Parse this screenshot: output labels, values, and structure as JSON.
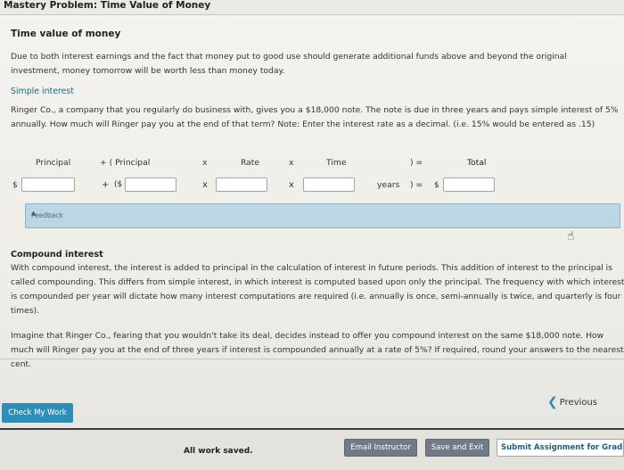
{
  "window": {
    "title": "Mastery Problem: Time Value of Money"
  },
  "section": {
    "title": "Time value of money"
  },
  "intro": "Due to both interest earnings and the fact that money put to good use should generate additional funds above and beyond the original investment, money tomorrow will be worth less than money today.",
  "simple": {
    "title": "Simple interest",
    "text": "Ringer Co., a company that you regularly do business with, gives you a $18,000 note. The note is due in three years and pays simple interest of 5% annually. How much will Ringer pay you at the end of that term? Note: Enter the interest rate as a decimal. (i.e. 15% would be entered as .15)",
    "headers": {
      "principal": "Principal",
      "plus_principal": "+  ( Principal",
      "x1": "x",
      "rate": "Rate",
      "x2": "x",
      "time": "Time",
      "close_eq": ")  =",
      "total": "Total"
    },
    "row": {
      "dollar1": "$",
      "plus": "+",
      "open_dollar": "($",
      "x1": "x",
      "x2": "x",
      "years": "years",
      "close_eq": ")  =",
      "dollar_total": "$"
    },
    "inputs": {
      "principal": "",
      "principal2": "",
      "rate": "",
      "time": "",
      "total": ""
    }
  },
  "feedback": {
    "label": "Feedback",
    "arrow": "▲"
  },
  "compound": {
    "title": "Compound interest",
    "text": "With compound interest, the interest is added to principal in the calculation of interest in future periods. This addition of interest to the principal is called compounding. This differs from simple interest, in which interest is computed based upon only the principal. The frequency with which interest is compounded per year will dictate how many interest computations are required (i.e. annually is once, semi-annually is twice, and quarterly is four times).",
    "question": "Imagine that Ringer Co., fearing that you wouldn't take its deal, decides instead to offer you compound interest on the same $18,000 note. How much will Ringer pay you at the end of three years if interest is compounded annually at a rate of 5%? If required, round your answers to the nearest cent."
  },
  "actions": {
    "check": "Check My Work",
    "previous": "Previous",
    "saved": "All work saved.",
    "email": "Email Instructor",
    "save_exit": "Save and Exit",
    "submit": "Submit Assignment for Grading"
  },
  "icons": {
    "previous": "chevron-left-icon",
    "cursor": "hand-pointer-icon"
  },
  "colors": {
    "accent": "#2d8fb8",
    "feedback_bg": "#bcd6e3",
    "link": "#1d6b80"
  }
}
